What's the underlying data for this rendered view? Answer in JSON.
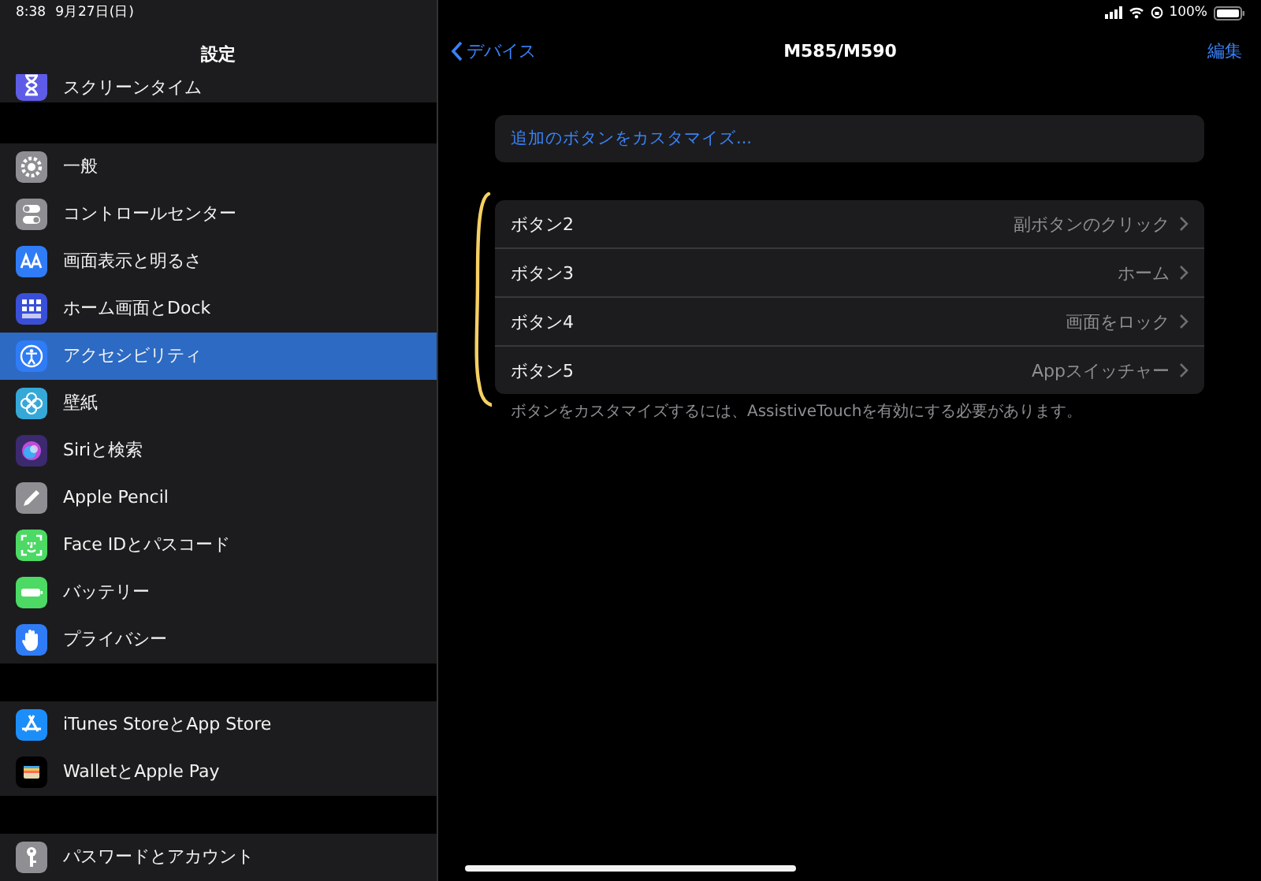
{
  "status_bar": {
    "time": "8:38",
    "date": "9月27日(日)",
    "battery": "100%"
  },
  "sidebar": {
    "title": "設定",
    "groups": [
      [
        {
          "label": "スクリーンタイム",
          "kind": "hourglass",
          "color": "#5e5ce6",
          "selected": false
        }
      ],
      [
        {
          "label": "一般",
          "kind": "gear",
          "color": "#8e8e93",
          "selected": false
        },
        {
          "label": "コントロールセンター",
          "kind": "toggles",
          "color": "#8e8e93",
          "selected": false
        },
        {
          "label": "画面表示と明るさ",
          "kind": "letters",
          "color": "#2f7cf6",
          "selected": false
        },
        {
          "label": "ホーム画面とDock",
          "kind": "grid",
          "color": "#3a4fd8",
          "selected": false
        },
        {
          "label": "アクセシビリティ",
          "kind": "person",
          "color": "#2f7cf6",
          "selected": true
        },
        {
          "label": "壁紙",
          "kind": "flower",
          "color": "#36a8d8",
          "selected": false
        },
        {
          "label": "Siriと検索",
          "kind": "orb",
          "color": "#3b2a6e",
          "selected": false
        },
        {
          "label": "Apple Pencil",
          "kind": "pencil",
          "color": "#8e8e93",
          "selected": false
        },
        {
          "label": "Face IDとパスコード",
          "kind": "face",
          "color": "#4cd964",
          "selected": false
        },
        {
          "label": "バッテリー",
          "kind": "battery",
          "color": "#4cd964",
          "selected": false
        },
        {
          "label": "プライバシー",
          "kind": "hand",
          "color": "#2f7cf6",
          "selected": false
        }
      ],
      [
        {
          "label": "iTunes StoreとApp Store",
          "kind": "store",
          "color": "#1c8ef9",
          "selected": false
        },
        {
          "label": "WalletとApple Pay",
          "kind": "wallet",
          "color": "#000000",
          "selected": false
        }
      ],
      [
        {
          "label": "パスワードとアカウント",
          "kind": "key",
          "color": "#8e8e93",
          "selected": false
        }
      ]
    ]
  },
  "detail": {
    "back": "デバイス",
    "title": "M585/M590",
    "edit": "編集",
    "customize": "追加のボタンをカスタマイズ...",
    "buttons": [
      {
        "label": "ボタン2",
        "value": "副ボタンのクリック"
      },
      {
        "label": "ボタン3",
        "value": "ホーム"
      },
      {
        "label": "ボタン4",
        "value": "画面をロック"
      },
      {
        "label": "ボタン5",
        "value": "Appスイッチャー"
      }
    ],
    "footnote": "ボタンをカスタマイズするには、AssistiveTouchを有効にする必要があります。"
  }
}
